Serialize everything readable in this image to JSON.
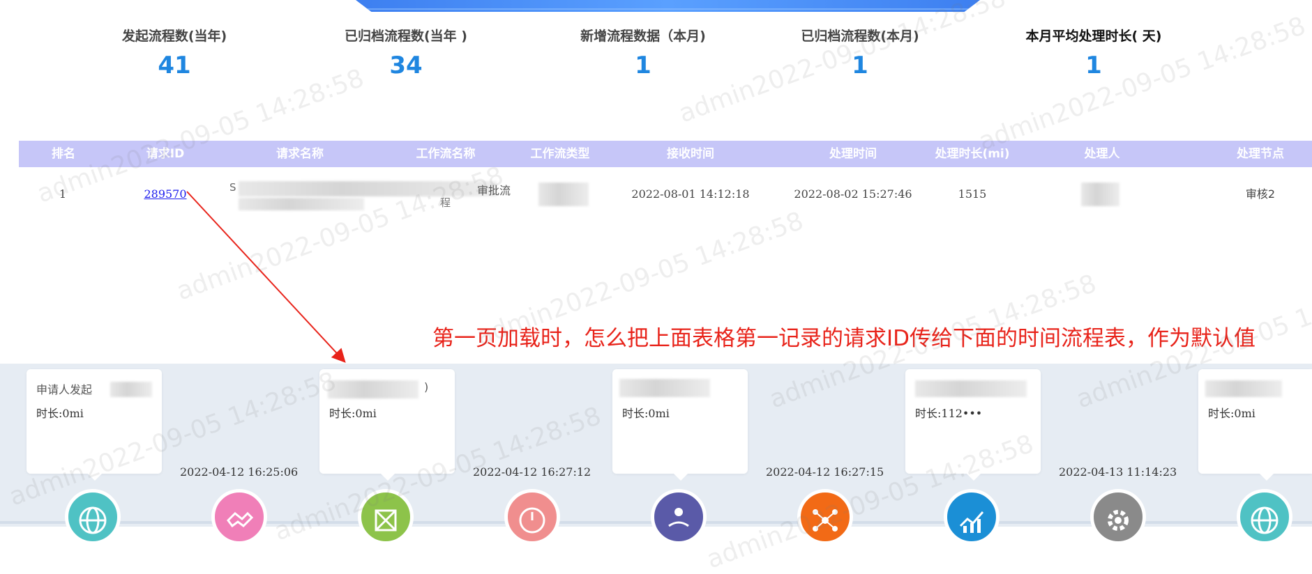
{
  "stats": [
    {
      "label": "发起流程数(当年)",
      "value": "41"
    },
    {
      "label": "已归档流程数(当年 )",
      "value": "34"
    },
    {
      "label": "新增流程数据（本月)",
      "value": "1"
    },
    {
      "label": "已归档流程数(本月)",
      "value": "1"
    },
    {
      "label": "本月平均处理时长( 天)",
      "value": "1"
    }
  ],
  "table": {
    "headers": [
      "排名",
      "请求ID",
      "请求名称",
      "工作流名称",
      "工作流类型",
      "接收时间",
      "处理时间",
      "处理时长(mi)",
      "处理人",
      "处理节点"
    ],
    "row": {
      "rank": "1",
      "request_id": "289570",
      "request_name_prefix": "S",
      "workflow_name_suffix": "审批流",
      "workflow_name_suffix2": "程",
      "receive_time": "2022-08-01 14:12:18",
      "process_time": "2022-08-02 15:27:46",
      "duration": "1515",
      "node": "审核2"
    }
  },
  "annotation": "第一页加载时，怎么把上面表格第一记录的请求ID传给下面的时间流程表，作为默认值",
  "timeline": {
    "cards": [
      {
        "title": "申请人发起",
        "duration": "时长:0mi"
      },
      {
        "title": "",
        "duration": "时长:0mi",
        "title_suffix": ")"
      },
      {
        "title": "",
        "duration": "时长:0mi"
      },
      {
        "title": "",
        "duration": "时长:112•••"
      },
      {
        "title": "",
        "duration": "时长:0mi"
      }
    ],
    "times": [
      "2022-04-12 16:25:06",
      "2022-04-12 16:27:12",
      "2022-04-12 16:27:15",
      "2022-04-13 11:14:23"
    ],
    "icons": [
      {
        "name": "globe-icon",
        "color": "#4fc2c4"
      },
      {
        "name": "handshake-icon",
        "color": "#f07fb8"
      },
      {
        "name": "cube-icon",
        "color": "#8dc34a"
      },
      {
        "name": "gauge-icon",
        "color": "#f08e8e"
      },
      {
        "name": "reader-icon",
        "color": "#5a5aa8"
      },
      {
        "name": "network-icon",
        "color": "#f26a16"
      },
      {
        "name": "growth-chart-icon",
        "color": "#1b8fd6"
      },
      {
        "name": "gear-icon",
        "color": "#8a8a8a"
      },
      {
        "name": "globe-icon",
        "color": "#4fc2c4"
      }
    ]
  },
  "watermark": "admin2022-09-05 14:28:58",
  "colors": {
    "accent": "#1f86e0",
    "header_bg": "#c6c6f8",
    "annotation": "#e8231a"
  }
}
